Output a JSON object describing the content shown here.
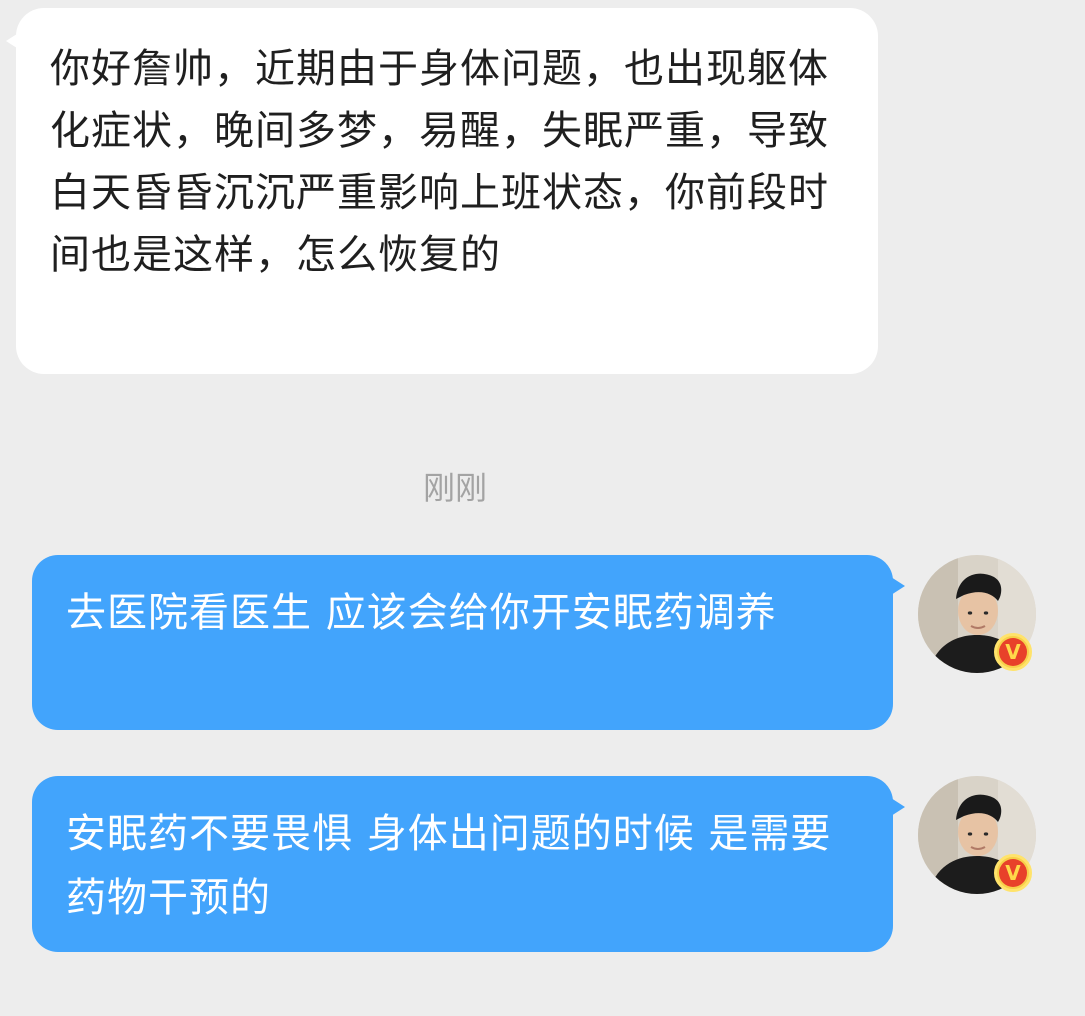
{
  "messages": [
    {
      "direction": "incoming",
      "text": "你好詹帅，近期由于身体问题，也出现躯体化症状，晚间多梦，易醒，失眠严重，导致白天昏昏沉沉严重影响上班状态，你前段时间也是这样，怎么恢复的"
    },
    {
      "direction": "outgoing",
      "text": "去医院看医生 应该会给你开安眠药调养"
    },
    {
      "direction": "outgoing",
      "text": "安眠药不要畏惧 身体出问题的时候 是需要药物干预的"
    }
  ],
  "timestamp": "刚刚",
  "avatar": {
    "icon": "user-avatar-photo",
    "badge_icon": "verified-v-badge-icon",
    "badge_text": "V"
  },
  "colors": {
    "background": "#ededed",
    "incoming_bubble": "#ffffff",
    "outgoing_bubble": "#42a4fc",
    "timestamp_text": "#a3a3a3",
    "badge_red": "#e8412a",
    "badge_gold": "#f7d04a"
  }
}
